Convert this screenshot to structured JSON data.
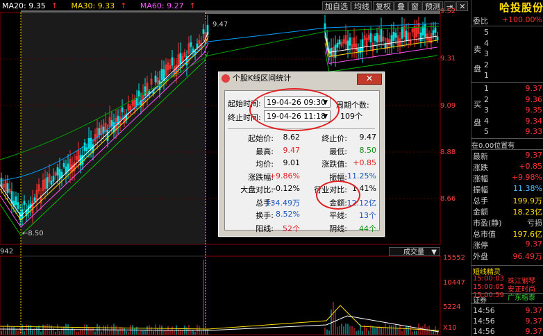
{
  "ma_legend": {
    "ma20_label": "MA20: 9.35",
    "ma30_label": "MA30: 9.33",
    "ma60_label": "MA60: 9.27",
    "arrow": "↑"
  },
  "toolbar": {
    "buttons": [
      "加自选",
      "均线",
      "复权",
      "叠",
      "窗",
      "预测"
    ],
    "pin_icon": "⇥",
    "close_icon": "✕"
  },
  "price_axis": [
    "9.52",
    "9.31",
    "9.09",
    "8.88",
    "8.66"
  ],
  "price_labels": {
    "high": "9.47",
    "low": "8.50",
    "vol_left": "942"
  },
  "volume": {
    "indicator_label": "成交量",
    "axis": [
      "15552",
      "10447",
      "5224",
      "X10"
    ]
  },
  "dialog": {
    "title": "个股K线区间统计",
    "close": "✕",
    "start_label": "起始时间:",
    "start_value": "19-04-26 09:30",
    "end_label": "终止时间:",
    "end_value": "19-04-26 11:18",
    "period_label": "周期个数:",
    "period_value": "109个",
    "rows": [
      {
        "l1": "起始价:",
        "v1": "8.62",
        "l2": "终止价:",
        "v2": "9.47"
      },
      {
        "l1": "最高:",
        "v1": "9.47",
        "l2": "最低:",
        "v2": "8.50"
      },
      {
        "l1": "均价:",
        "v1": "9.01",
        "l2": "涨跌值:",
        "v2": "+0.85"
      },
      {
        "l1": "涨跌幅:",
        "v1": "+9.86%",
        "l2": "振幅:",
        "v2": "11.25%"
      },
      {
        "l1": "大盘对比:",
        "v1": "-0.12%",
        "l2": "行业对比:",
        "v2": "1.41%"
      },
      {
        "l1": "总手:",
        "v1": "134.49万",
        "l2": "金额:",
        "v2": "12.12亿"
      },
      {
        "l1": "换手:",
        "v1": "8.52%",
        "l2": "平线:",
        "v2": "13个"
      },
      {
        "l1": "阳线:",
        "v1": "52个",
        "l2": "阴线:",
        "v2": "44个"
      }
    ]
  },
  "right_panel": {
    "stock_name": "哈投股份",
    "weibi_label": "委比",
    "weibi_value": "+100.00%",
    "sell_side": "卖盘",
    "buy_side": "买盘",
    "sell_levels": [
      "5",
      "4",
      "3",
      "2",
      "1"
    ],
    "buy_levels": [
      {
        "n": "1",
        "p": "9.37"
      },
      {
        "n": "2",
        "p": "9.36"
      },
      {
        "n": "3",
        "p": "9.35"
      },
      {
        "n": "4",
        "p": "9.34"
      },
      {
        "n": "5",
        "p": "9.33"
      }
    ],
    "status": "在0.00位置有",
    "quote": [
      {
        "k": "最新",
        "v": "9.37"
      },
      {
        "k": "涨跌",
        "v": "+0.85"
      },
      {
        "k": "涨幅",
        "v": "+9.98%"
      },
      {
        "k": "振幅",
        "v": "11.38%"
      },
      {
        "k": "总手",
        "v": "199.9万"
      },
      {
        "k": "金额",
        "v": "18.23亿"
      },
      {
        "k": "市盈(静)",
        "v": "亏损"
      },
      {
        "k": "总市值",
        "v": "197.6亿"
      },
      {
        "k": "涨停",
        "v": "9.37"
      },
      {
        "k": "外盘",
        "v": "96.49万"
      }
    ],
    "short_line_title": "短线精灵",
    "short_line": [
      {
        "t": "15:00:03",
        "n": "珠江钢琴"
      },
      {
        "t": "15:00:05",
        "n": "安正时尚"
      },
      {
        "t": "15:00:59",
        "n": "广东榕泰"
      }
    ],
    "ticks_title": "证券",
    "ticks": [
      {
        "t": "14:56",
        "p": "9.37"
      },
      {
        "t": "14:56",
        "p": "9.37"
      },
      {
        "t": "14:56",
        "p": "9.37"
      }
    ]
  }
}
